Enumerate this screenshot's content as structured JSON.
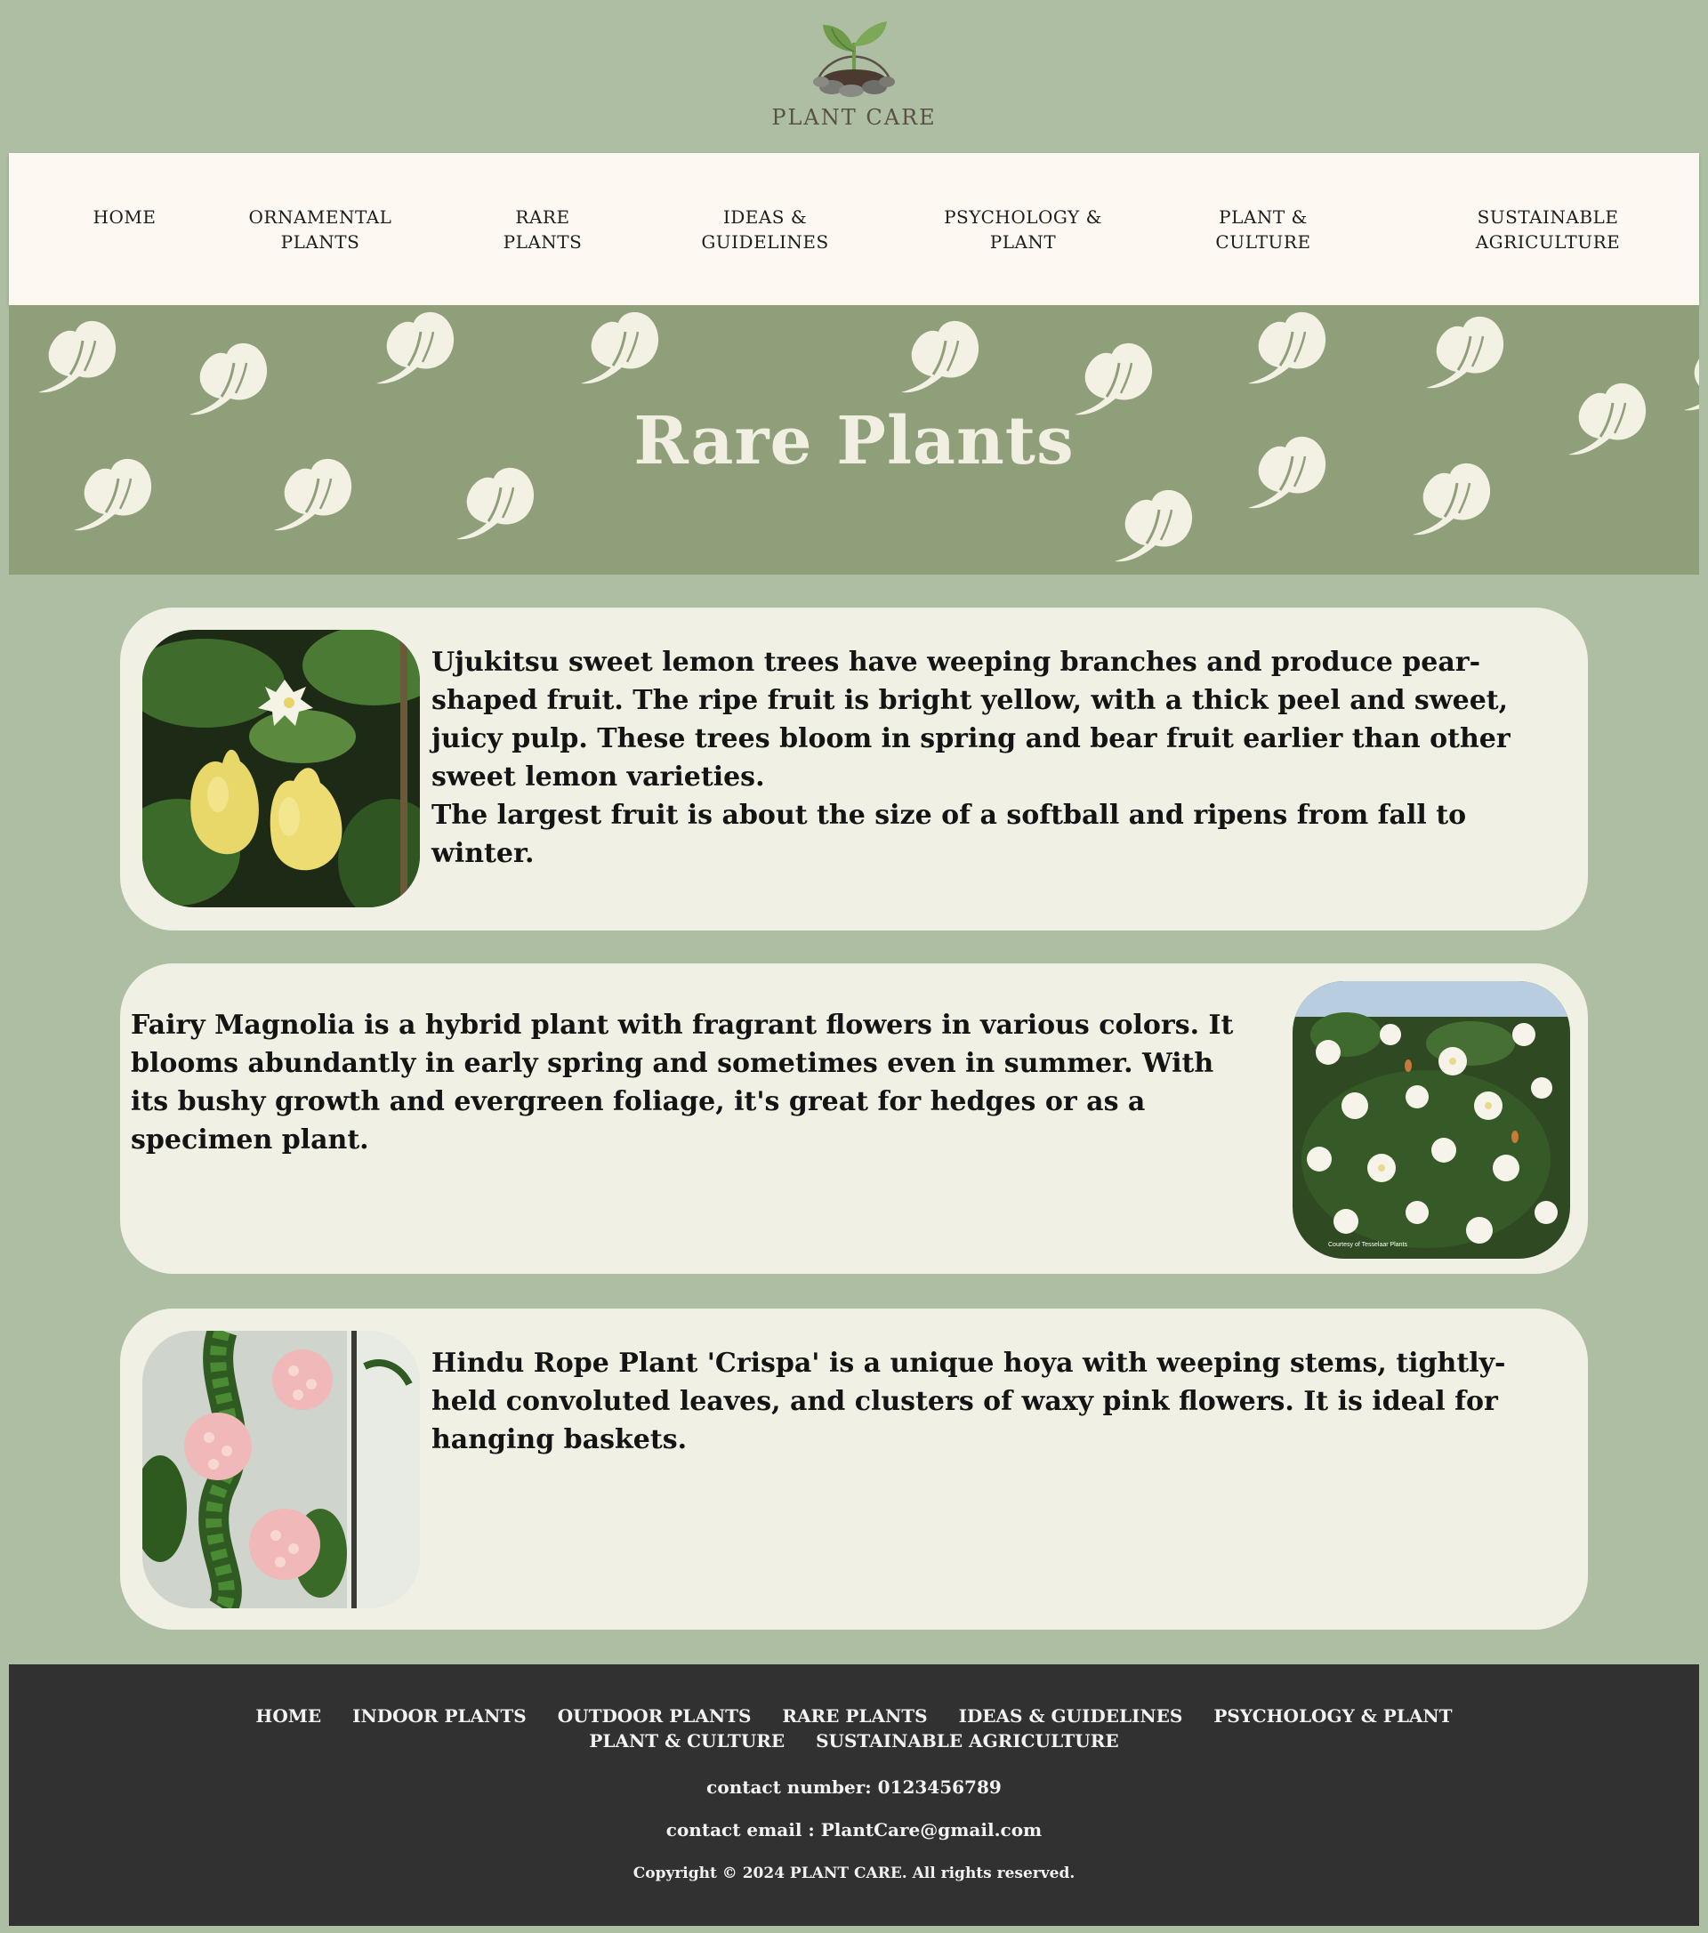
{
  "brand": {
    "name": "PLANT CARE",
    "colors": {
      "background": "#adbea3",
      "nav_bg": "#fdf8f2",
      "banner_bg": "#8f9f79",
      "card_bg": "#f0f0e4",
      "footer_bg": "#313131",
      "leaf": "#f2f1e3"
    }
  },
  "nav": {
    "items": [
      {
        "label": "HOME"
      },
      {
        "label": "ORNAMENTAL\nPLANTS"
      },
      {
        "label": "RARE\nPLANTS"
      },
      {
        "label": "IDEAS &\nGUIDELINES"
      },
      {
        "label": "PSYCHOLOGY &\nPLANT"
      },
      {
        "label": "PLANT &\nCULTURE"
      },
      {
        "label": "SUSTAINABLE\nAGRICULTURE"
      }
    ]
  },
  "banner": {
    "title": "Rare Plants"
  },
  "cards": [
    {
      "image": "lemon-photo",
      "paragraphs": [
        "Ujukitsu sweet lemon trees have weeping branches and produce pear-shaped fruit. The ripe fruit is bright yellow, with a thick peel and sweet, juicy pulp. These trees bloom in spring and bear fruit earlier than other sweet lemon varieties.",
        "The largest fruit is about the size of a softball and ripens from fall to winter."
      ]
    },
    {
      "image": "magnolia-photo",
      "image_caption": "Courtesy of Tesselaar Plants",
      "paragraphs": [
        "Fairy Magnolia is a hybrid plant with fragrant flowers in various colors. It blooms abundantly in early spring and sometimes even in summer. With its bushy growth and evergreen foliage, it's great for hedges or as a specimen plant."
      ]
    },
    {
      "image": "hoya-photo",
      "paragraphs": [
        "Hindu Rope Plant 'Crispa' is a unique hoya with weeping stems, tightly-held convoluted leaves, and clusters of waxy pink flowers. It is ideal for hanging baskets."
      ]
    }
  ],
  "footer": {
    "links": [
      "HOME",
      "INDOOR PLANTS",
      "OUTDOOR PLANTS",
      "RARE PLANTS",
      "IDEAS & GUIDELINES",
      "PSYCHOLOGY & PLANT",
      "PLANT & CULTURE",
      "SUSTAINABLE AGRICULTURE"
    ],
    "contact_number": "contact number: 0123456789",
    "contact_email": "contact email : PlantCare@gmail.com",
    "copyright": "Copyright © 2024 PLANT CARE. All rights reserved."
  }
}
